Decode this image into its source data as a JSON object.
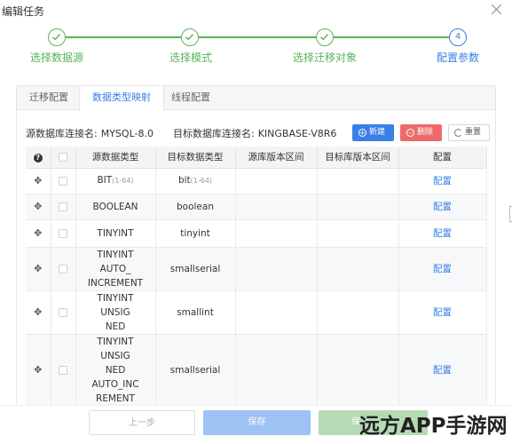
{
  "dialog": {
    "title": "编辑任务"
  },
  "steps": [
    {
      "label": "选择数据源",
      "state": "done"
    },
    {
      "label": "选择模式",
      "state": "done"
    },
    {
      "label": "选择迁移对象",
      "state": "done"
    },
    {
      "label": "配置参数",
      "state": "active",
      "number": "4"
    }
  ],
  "tabs": [
    {
      "label": "迁移配置"
    },
    {
      "label": "数据类型映射",
      "active": true
    },
    {
      "label": "线程配置"
    }
  ],
  "connections": {
    "source_label": "源数据库连接名:",
    "source_value": "MYSQL-8.0",
    "target_label": "目标数据库连接名:",
    "target_value": "KINGBASE-V8R6"
  },
  "toolbar": {
    "new_label": "新建",
    "delete_label": "删除",
    "reset_label": "重置"
  },
  "table": {
    "headers": [
      "",
      "",
      "源数据类型",
      "目标数据类型",
      "源库版本区间",
      "目标库版本区间",
      "配置"
    ],
    "rows": [
      {
        "src": "BIT",
        "src_range": "(1-64)",
        "dst": "bit",
        "dst_range": "(1-64)",
        "action": "配置"
      },
      {
        "src": "BOOLEAN",
        "src_range": "",
        "dst": "boolean",
        "dst_range": "",
        "action": "配置"
      },
      {
        "src": "TINYINT",
        "src_range": "",
        "dst": "tinyint",
        "dst_range": "",
        "action": "配置"
      },
      {
        "src": "TINYINT AUTO_\nINCREMENT",
        "src_range": "",
        "dst": "smallserial",
        "dst_range": "",
        "action": "配置"
      },
      {
        "src": "TINYINT UNSIG\nNED",
        "src_range": "",
        "dst": "smallint",
        "dst_range": "",
        "action": "配置"
      },
      {
        "src": "TINYINT UNSIG\nNED AUTO_INC\nREMENT",
        "src_range": "",
        "dst": "smallserial",
        "dst_range": "",
        "action": "配置"
      }
    ]
  },
  "footer": {
    "prev_label": "上一步",
    "save_label": "保存",
    "save_start_label": "保"
  },
  "watermark": "远方APP手游网",
  "colors": {
    "primary": "#3a7fe6",
    "success": "#56b45b",
    "danger": "#ee6a6a"
  }
}
